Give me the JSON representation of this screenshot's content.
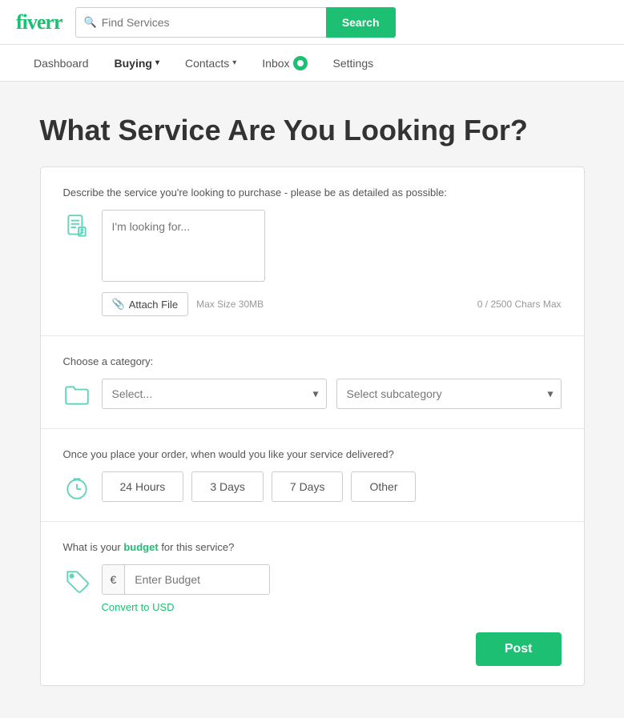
{
  "header": {
    "logo": "fiverr",
    "search_placeholder": "Find Services",
    "search_button_label": "Search"
  },
  "nav": {
    "items": [
      {
        "id": "dashboard",
        "label": "Dashboard",
        "active": false,
        "has_dropdown": false
      },
      {
        "id": "buying",
        "label": "Buying",
        "active": true,
        "has_dropdown": true
      },
      {
        "id": "contacts",
        "label": "Contacts",
        "active": false,
        "has_dropdown": true
      },
      {
        "id": "inbox",
        "label": "Inbox",
        "active": false,
        "has_dropdown": false,
        "has_badge": true,
        "badge_count": ""
      },
      {
        "id": "settings",
        "label": "Settings",
        "active": false,
        "has_dropdown": false
      }
    ]
  },
  "page": {
    "title": "What Service Are You Looking For?"
  },
  "form": {
    "describe_label": "Describe the service you're looking to purchase - please be as detailed as possible:",
    "textarea_placeholder": "I'm looking for...",
    "attach_button_label": "Attach File",
    "max_size_label": "Max Size 30MB",
    "char_count": "0 / 2500 Chars Max",
    "category_label": "Choose a category:",
    "category_placeholder": "Select...",
    "subcategory_placeholder": "Select subcategory",
    "delivery_label": "Once you place your order, when would you like your service delivered?",
    "delivery_options": [
      {
        "id": "24hours",
        "label": "24 Hours"
      },
      {
        "id": "3days",
        "label": "3 Days"
      },
      {
        "id": "7days",
        "label": "7 Days"
      },
      {
        "id": "other",
        "label": "Other"
      }
    ],
    "budget_label": "What is your budget for this service?",
    "budget_currency": "€",
    "budget_placeholder": "Enter Budget",
    "convert_link_label": "Convert to USD",
    "post_button_label": "Post"
  }
}
